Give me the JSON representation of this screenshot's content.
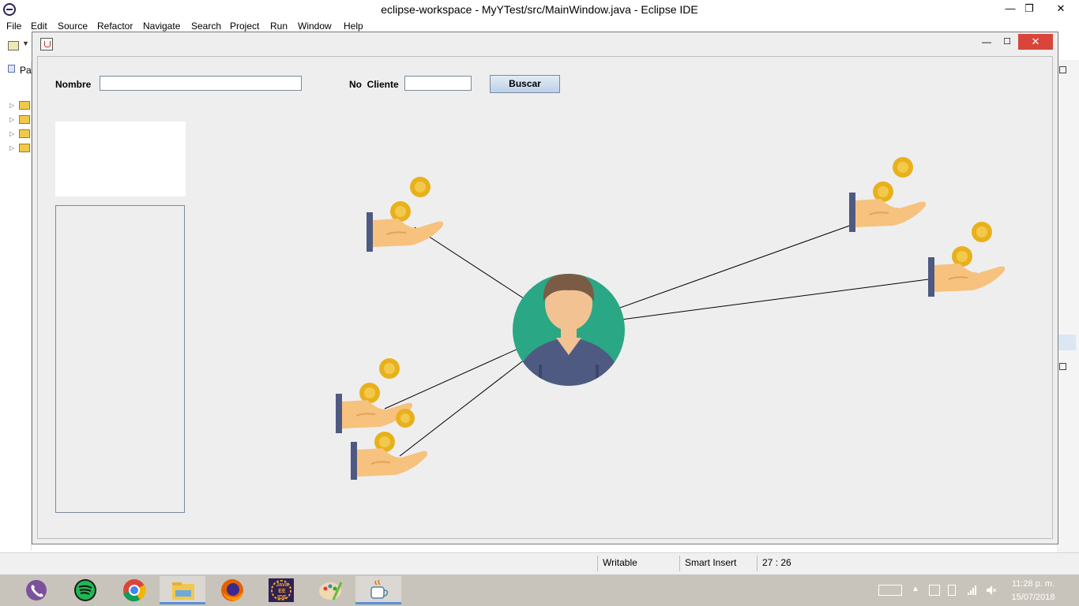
{
  "eclipse": {
    "window_title": "eclipse-workspace - MyYTest/src/MainWindow.java - Eclipse IDE",
    "menu": [
      "File",
      "Edit",
      "Source",
      "Refactor",
      "Navigate",
      "Search",
      "Project",
      "Run",
      "Window",
      "Help"
    ],
    "package_tab": "Pa",
    "status": {
      "writable": "Writable",
      "insert_mode": "Smart Insert",
      "cursor_position": "27 : 26"
    }
  },
  "swing_window": {
    "nombre_label": "Nombre",
    "nombre_value": "",
    "no_cliente_label": "No  Cliente",
    "no_cliente_value": "",
    "buscar_button": "Buscar"
  },
  "taskbar": {
    "apps": [
      "viber-icon",
      "spotify-icon",
      "chrome-icon",
      "file-explorer-icon",
      "firefox-icon",
      "java-ee-ide-icon",
      "paint-icon",
      "java-app-icon"
    ],
    "java_ee_badge": "Java EE IDE",
    "clock_time": "11:28 p. m.",
    "clock_date": "15/07/2018"
  },
  "colors": {
    "avatar_circle": "#2aa784",
    "coin": "#e8b11c",
    "hand_skin": "#f6c27e",
    "sleeve": "#4e5a82",
    "close_button": "#d9453b"
  }
}
